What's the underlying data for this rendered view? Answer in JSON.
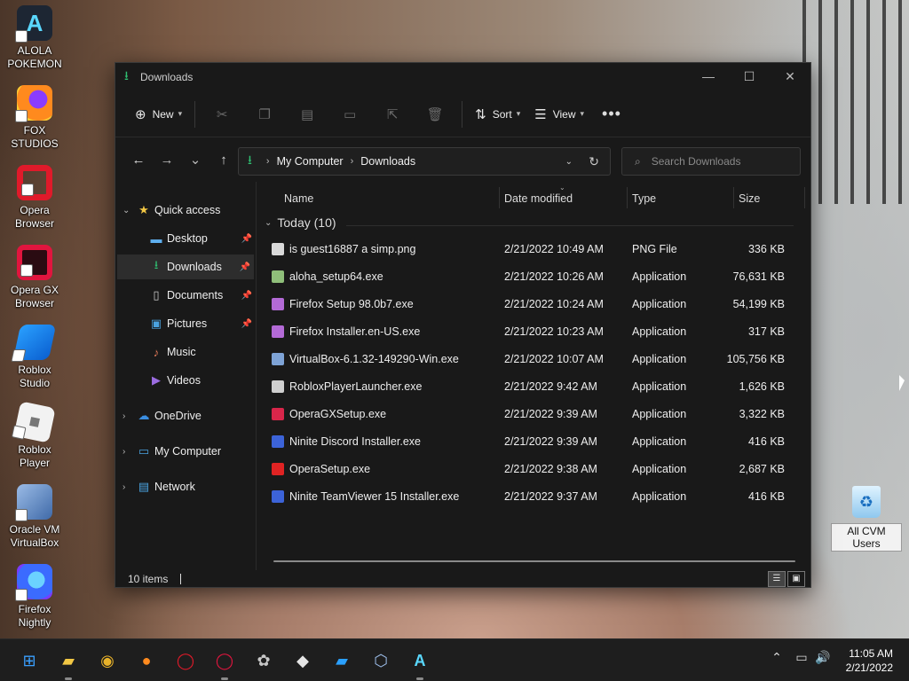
{
  "desktop": {
    "icons": [
      {
        "label_1": "ALOLA",
        "label_2": "POKEMON",
        "icon": "alola-icon"
      },
      {
        "label_1": "FOX STUDIOS",
        "label_2": "",
        "icon": "firefox-icon"
      },
      {
        "label_1": "Opera",
        "label_2": "Browser",
        "icon": "opera-icon"
      },
      {
        "label_1": "Opera GX",
        "label_2": "Browser",
        "icon": "opera-gx-icon"
      },
      {
        "label_1": "Roblox Studio",
        "label_2": "",
        "icon": "roblox-studio-icon"
      },
      {
        "label_1": "Roblox Player",
        "label_2": "",
        "icon": "roblox-player-icon"
      },
      {
        "label_1": "Oracle VM",
        "label_2": "VirtualBox",
        "icon": "virtualbox-icon"
      },
      {
        "label_1": "Firefox",
        "label_2": "Nightly",
        "icon": "firefox-nightly-icon"
      }
    ],
    "recycle_label": "All CVM Users"
  },
  "window": {
    "title": "Downloads",
    "commands": {
      "new": "New",
      "sort": "Sort",
      "view": "View",
      "more": "•••"
    },
    "address": {
      "root": "My Computer",
      "current": "Downloads"
    },
    "search_placeholder": "Search Downloads"
  },
  "nav": {
    "quick_access": "Quick access",
    "items": [
      "Desktop",
      "Downloads",
      "Documents",
      "Pictures",
      "Music",
      "Videos"
    ],
    "onedrive": "OneDrive",
    "my_computer": "My Computer",
    "network": "Network"
  },
  "columns": {
    "name": "Name",
    "date": "Date modified",
    "type": "Type",
    "size": "Size"
  },
  "group_label": "Today (10)",
  "files": [
    {
      "name": "is guest16887 a simp.png",
      "date": "2/21/2022 10:49 AM",
      "type": "PNG File",
      "size": "336 KB",
      "color": "#d9d9d9"
    },
    {
      "name": "aloha_setup64.exe",
      "date": "2/21/2022 10:26 AM",
      "type": "Application",
      "size": "76,631 KB",
      "color": "#8fbf7a"
    },
    {
      "name": "Firefox Setup 98.0b7.exe",
      "date": "2/21/2022 10:24 AM",
      "type": "Application",
      "size": "54,199 KB",
      "color": "#b36ad6"
    },
    {
      "name": "Firefox Installer.en-US.exe",
      "date": "2/21/2022 10:23 AM",
      "type": "Application",
      "size": "317 KB",
      "color": "#b36ad6"
    },
    {
      "name": "VirtualBox-6.1.32-149290-Win.exe",
      "date": "2/21/2022 10:07 AM",
      "type": "Application",
      "size": "105,756 KB",
      "color": "#7ea3d6"
    },
    {
      "name": "RobloxPlayerLauncher.exe",
      "date": "2/21/2022 9:42 AM",
      "type": "Application",
      "size": "1,626 KB",
      "color": "#cfcfcf"
    },
    {
      "name": "OperaGXSetup.exe",
      "date": "2/21/2022 9:39 AM",
      "type": "Application",
      "size": "3,322 KB",
      "color": "#d8264a"
    },
    {
      "name": "Ninite Discord Installer.exe",
      "date": "2/21/2022 9:39 AM",
      "type": "Application",
      "size": "416 KB",
      "color": "#3c63d8"
    },
    {
      "name": "OperaSetup.exe",
      "date": "2/21/2022 9:38 AM",
      "type": "Application",
      "size": "2,687 KB",
      "color": "#e02323"
    },
    {
      "name": "Ninite TeamViewer 15 Installer.exe",
      "date": "2/21/2022 9:37 AM",
      "type": "Application",
      "size": "416 KB",
      "color": "#3c63d8"
    }
  ],
  "status": {
    "count": "10 items"
  },
  "taskbar": {
    "time": "11:05 AM",
    "date": "2/21/2022"
  }
}
